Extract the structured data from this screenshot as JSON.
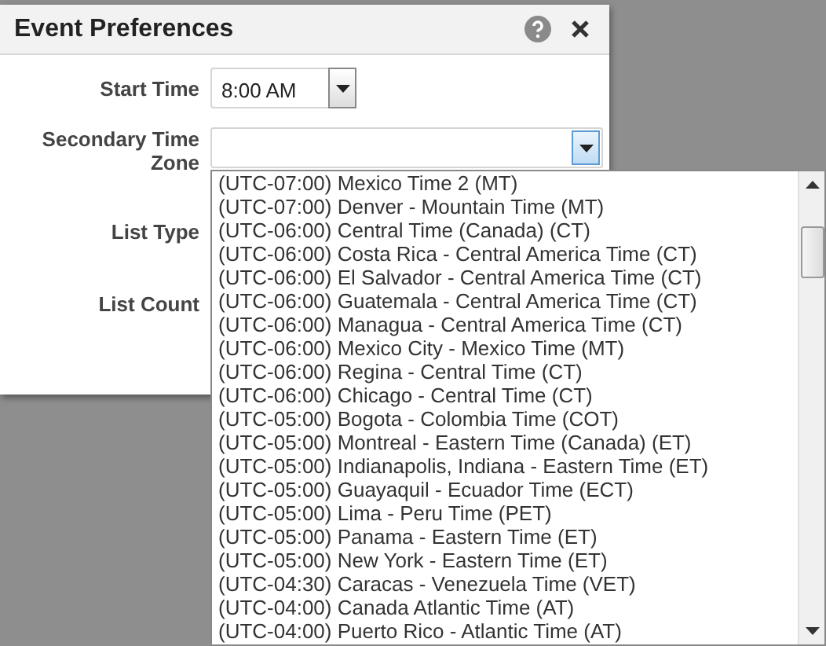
{
  "dialog": {
    "title": "Event Preferences"
  },
  "fields": [
    {
      "kind": "select",
      "label": "Start Time",
      "value": "8:00 AM"
    },
    {
      "kind": "select-wide",
      "label": "Secondary Time Zone"
    },
    {
      "kind": "text",
      "label": "List Type"
    },
    {
      "kind": "text",
      "label": "List Count"
    }
  ],
  "dropdown": {
    "options": [
      {
        "label": "(UTC-07:00) Mexico Time 2 (MT)"
      },
      {
        "label": "(UTC-07:00) Denver - Mountain Time (MT)"
      },
      {
        "label": "(UTC-06:00) Central Time (Canada) (CT)"
      },
      {
        "label": "(UTC-06:00) Costa Rica - Central America Time (CT)"
      },
      {
        "label": "(UTC-06:00) El Salvador - Central America Time (CT)"
      },
      {
        "label": "(UTC-06:00) Guatemala - Central America Time (CT)"
      },
      {
        "label": "(UTC-06:00) Managua - Central America Time (CT)"
      },
      {
        "label": "(UTC-06:00) Mexico City - Mexico Time (MT)"
      },
      {
        "label": "(UTC-06:00) Regina - Central Time (CT)"
      },
      {
        "label": "(UTC-06:00) Chicago - Central Time (CT)"
      },
      {
        "label": "(UTC-05:00) Bogota - Colombia Time (COT)"
      },
      {
        "label": "(UTC-05:00) Montreal - Eastern Time (Canada) (ET)"
      },
      {
        "label": "(UTC-05:00) Indianapolis, Indiana - Eastern Time (ET)"
      },
      {
        "label": "(UTC-05:00) Guayaquil - Ecuador Time (ECT)"
      },
      {
        "label": "(UTC-05:00) Lima - Peru Time (PET)"
      },
      {
        "label": "(UTC-05:00) Panama - Eastern Time (ET)"
      },
      {
        "label": "(UTC-05:00) New York - Eastern Time (ET)"
      },
      {
        "label": "(UTC-04:30) Caracas - Venezuela Time (VET)"
      },
      {
        "label": "(UTC-04:00) Canada Atlantic Time (AT)"
      },
      {
        "label": "(UTC-04:00) Puerto Rico - Atlantic Time (AT)"
      }
    ]
  }
}
